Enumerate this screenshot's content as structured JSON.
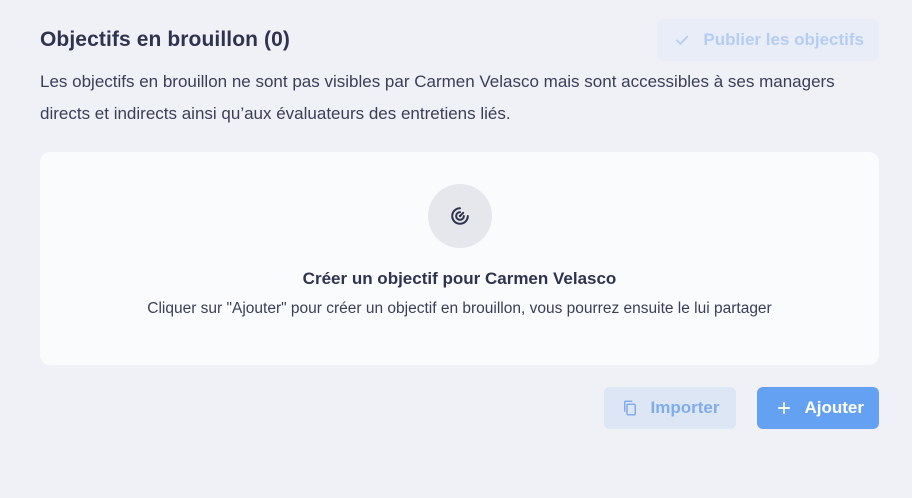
{
  "header": {
    "title": "Objectifs en brouillon (0)",
    "publish_label": "Publier les objectifs",
    "publish_icon": "check-icon"
  },
  "description": "Les objectifs en brouillon ne sont pas visibles par Carmen Velasco mais sont accessibles à ses managers directs et indirects ainsi qu’aux évaluateurs des entretiens liés.",
  "empty_state": {
    "icon": "target-icon",
    "title": "Créer un objectif pour Carmen Velasco",
    "subtitle": "Cliquer sur \"Ajouter\" pour créer un objectif en brouillon, vous pourrez ensuite le lui partager"
  },
  "actions": {
    "import_label": "Importer",
    "import_icon": "copy-icon",
    "add_label": "Ajouter",
    "add_icon": "plus-icon"
  },
  "colors": {
    "background": "#f0f1f6",
    "card": "#fafbfd",
    "primary": "#64a1f2",
    "secondary_bg": "#dce6f5",
    "disabled_bg": "#e8edf7",
    "disabled_text": "#b5cdf3",
    "text": "#2f3350"
  }
}
